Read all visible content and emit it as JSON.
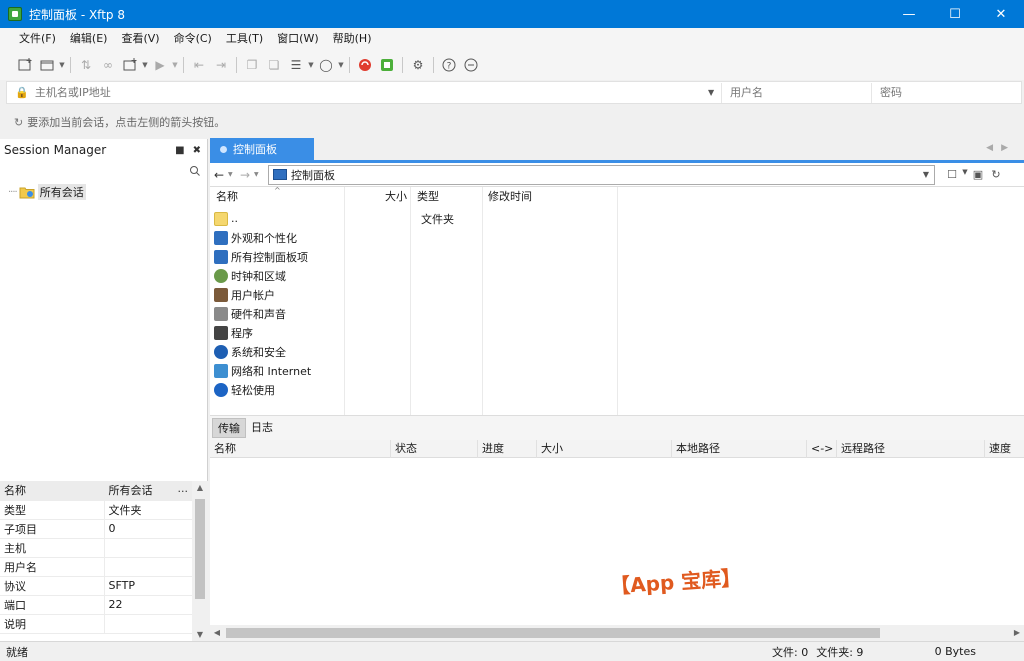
{
  "window": {
    "title": "控制面板 - Xftp 8"
  },
  "menu": [
    "文件(F)",
    "编辑(E)",
    "查看(V)",
    "命令(C)",
    "工具(T)",
    "窗口(W)",
    "帮助(H)"
  ],
  "address": {
    "host_placeholder": "主机名或IP地址",
    "user_placeholder": "用户名",
    "pass_placeholder": "密码"
  },
  "hint": "要添加当前会话，点击左侧的箭头按钮。",
  "session": {
    "title": "Session Manager",
    "tree_root": "所有会话"
  },
  "props": [
    {
      "k": "名称",
      "v": "所有会话"
    },
    {
      "k": "类型",
      "v": "文件夹"
    },
    {
      "k": "子项目",
      "v": "0"
    },
    {
      "k": "主机",
      "v": ""
    },
    {
      "k": "用户名",
      "v": ""
    },
    {
      "k": "协议",
      "v": "SFTP"
    },
    {
      "k": "端口",
      "v": "22"
    },
    {
      "k": "说明",
      "v": ""
    }
  ],
  "tab": {
    "label": "控制面板"
  },
  "path": {
    "current": "控制面板"
  },
  "file_list": {
    "headers": {
      "name": "名称",
      "size": "大小",
      "type": "类型",
      "modified": "修改时间"
    },
    "items": [
      {
        "name": "..",
        "type": "文件夹",
        "icon": "folder-icon",
        "color": "#f5d76e"
      },
      {
        "name": "外观和个性化",
        "type": "",
        "icon": "appearance-icon",
        "color": "#2f6fbf"
      },
      {
        "name": "所有控制面板项",
        "type": "",
        "icon": "control-panel-icon",
        "color": "#2f6fbf"
      },
      {
        "name": "时钟和区域",
        "type": "",
        "icon": "clock-icon",
        "color": "#6a9a4a"
      },
      {
        "name": "用户帐户",
        "type": "",
        "icon": "users-icon",
        "color": "#7b5a3a"
      },
      {
        "name": "硬件和声音",
        "type": "",
        "icon": "hardware-icon",
        "color": "#8a8a8a"
      },
      {
        "name": "程序",
        "type": "",
        "icon": "programs-icon",
        "color": "#444444"
      },
      {
        "name": "系统和安全",
        "type": "",
        "icon": "security-icon",
        "color": "#1e5fb3"
      },
      {
        "name": "网络和 Internet",
        "type": "",
        "icon": "network-icon",
        "color": "#3d8fd1"
      },
      {
        "name": "轻松使用",
        "type": "",
        "icon": "ease-of-access-icon",
        "color": "#1c64c4"
      }
    ]
  },
  "transfer": {
    "tabs": [
      "传输",
      "日志"
    ],
    "columns": [
      "名称",
      "状态",
      "进度",
      "大小",
      "本地路径",
      "<->",
      "远程路径",
      "速度"
    ]
  },
  "watermark": "【App 宝库】",
  "status": {
    "left": "就绪",
    "files": "文件: 0",
    "folders": "文件夹: 9",
    "bytes": "0 Bytes"
  },
  "colors": {
    "titlebar": "#0078d7",
    "accent": "#3a8ee6"
  }
}
